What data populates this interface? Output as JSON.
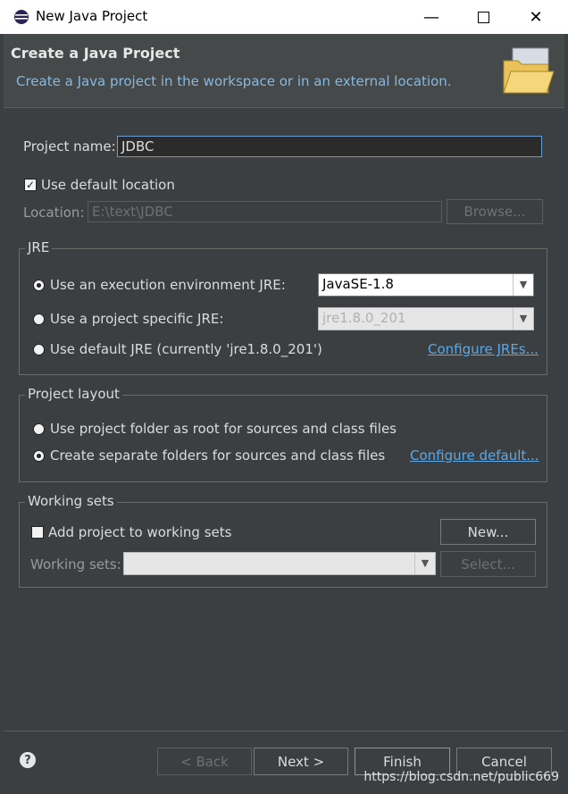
{
  "window": {
    "title": "New Java Project"
  },
  "header": {
    "title": "Create a Java Project",
    "description": "Create a Java project in the workspace or in an external location."
  },
  "project": {
    "name_label": "Project name:",
    "name_value": "JDBC"
  },
  "location": {
    "use_default_label": "Use default location",
    "label": "Location:",
    "value": "E:\\text\\JDBC",
    "browse_label": "Browse..."
  },
  "jre": {
    "group_label": "JRE",
    "execution_env_label": "Use an execution environment JRE:",
    "execution_env_value": "JavaSE-1.8",
    "project_specific_label": "Use a project specific JRE:",
    "project_specific_value": "jre1.8.0_201",
    "default_label": "Use default JRE (currently 'jre1.8.0_201')",
    "configure_link": "Configure JREs..."
  },
  "layout": {
    "group_label": "Project layout",
    "root_option": "Use project folder as root for sources and class files",
    "separate_option": "Create separate folders for sources and class files",
    "configure_link": "Configure default..."
  },
  "working_sets": {
    "group_label": "Working sets",
    "add_label": "Add project to working sets",
    "new_button": "New...",
    "sets_label": "Working sets:",
    "select_button": "Select..."
  },
  "footer": {
    "back_button": "< Back",
    "next_button": "Next >",
    "finish_button": "Finish",
    "cancel_button": "Cancel",
    "watermark": "https://blog.csdn.net/public669"
  },
  "colors": {
    "accent": "#6a9cd0",
    "link": "#5aa9e6",
    "background": "#3c3f41"
  }
}
